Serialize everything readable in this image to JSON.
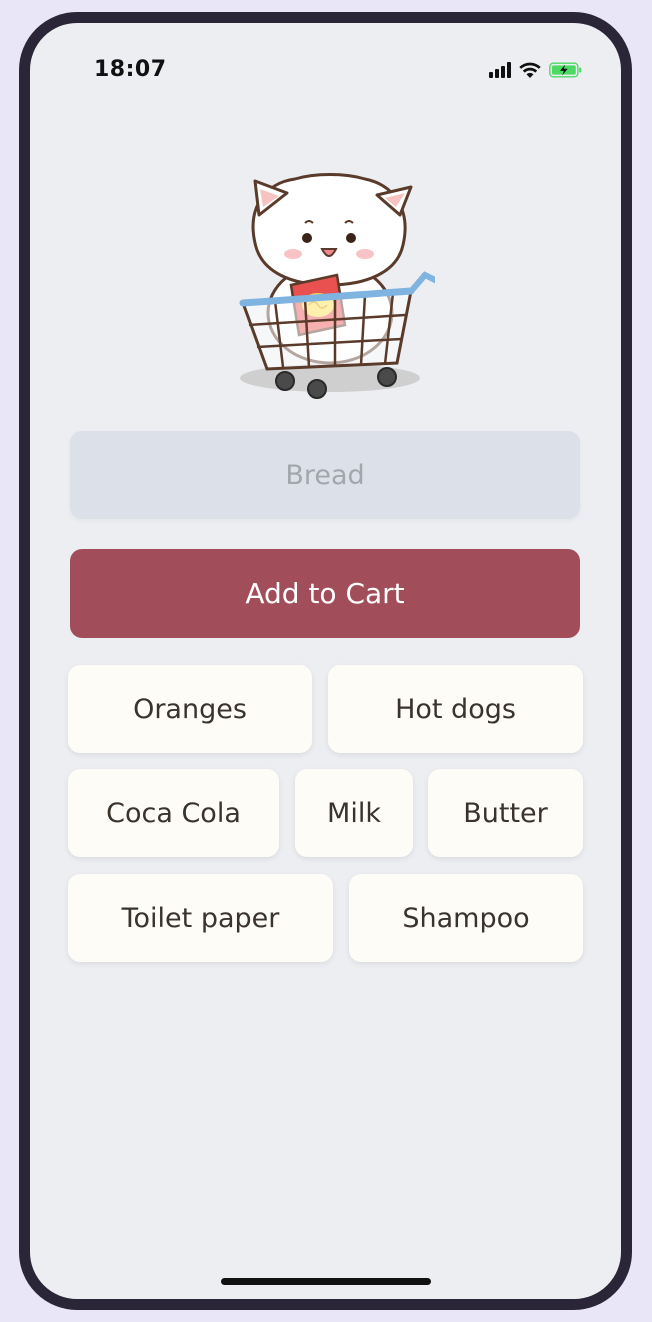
{
  "status_bar": {
    "time": "18:07",
    "icons": [
      "cellular-signal-icon",
      "wifi-icon",
      "battery-charging-icon"
    ],
    "battery_color": "#4cd964"
  },
  "illustration": {
    "name": "cat-in-shopping-cart-illustration"
  },
  "item_input": {
    "value": "",
    "placeholder": "Bread"
  },
  "add_button": {
    "label": "Add to Cart",
    "color": "#a14e5a"
  },
  "suggestions": [
    {
      "label": "Oranges"
    },
    {
      "label": "Hot dogs"
    },
    {
      "label": "Coca Cola"
    },
    {
      "label": "Milk"
    },
    {
      "label": "Butter"
    },
    {
      "label": "Toilet paper"
    },
    {
      "label": "Shampoo"
    }
  ],
  "colors": {
    "background": "#eceef2",
    "chip": "#fdfcf7",
    "input": "#dce0e9"
  }
}
